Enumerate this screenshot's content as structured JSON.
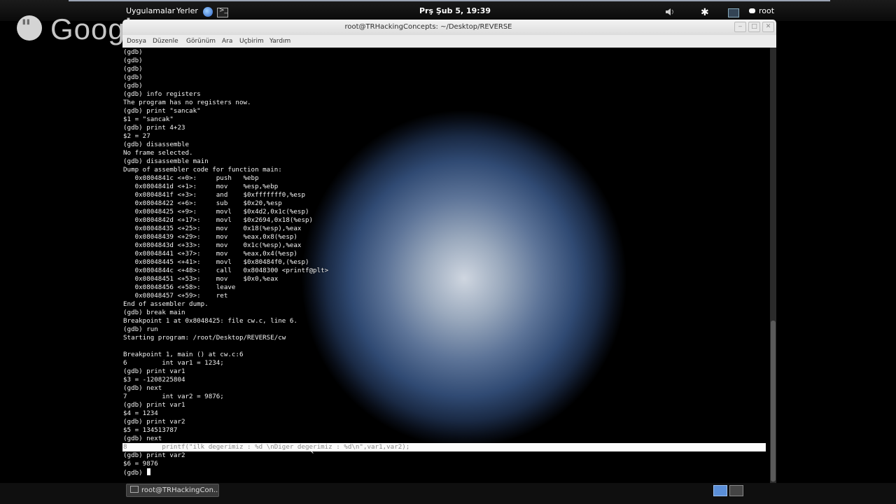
{
  "top_panel": {
    "apps_label": "Uygulamalar",
    "places_label": "Yerler",
    "clock": "Prş Şub  5, 19:39",
    "user": "root"
  },
  "overlay": {
    "wordmark": "Google+"
  },
  "window": {
    "title": "root@TRHackingConcepts: ~/Desktop/REVERSE",
    "menu": [
      "Dosya",
      "Düzenle",
      "Görünüm",
      "Ara",
      "Uçbirim",
      "Yardım"
    ]
  },
  "terminal": {
    "lines": [
      "(gdb)",
      "(gdb)",
      "(gdb)",
      "(gdb)",
      "(gdb)",
      "(gdb) info registers",
      "The program has no registers now.",
      "(gdb) print \"sancak\"",
      "$1 = \"sancak\"",
      "(gdb) print 4+23",
      "$2 = 27",
      "(gdb) disassemble",
      "No frame selected.",
      "(gdb) disassemble main",
      "Dump of assembler code for function main:",
      "   0x0804841c <+0>:     push   %ebp",
      "   0x0804841d <+1>:     mov    %esp,%ebp",
      "   0x0804841f <+3>:     and    $0xfffffff0,%esp",
      "   0x08048422 <+6>:     sub    $0x20,%esp",
      "   0x08048425 <+9>:     movl   $0x4d2,0x1c(%esp)",
      "   0x0804842d <+17>:    movl   $0x2694,0x18(%esp)",
      "   0x08048435 <+25>:    mov    0x18(%esp),%eax",
      "   0x08048439 <+29>:    mov    %eax,0x8(%esp)",
      "   0x0804843d <+33>:    mov    0x1c(%esp),%eax",
      "   0x08048441 <+37>:    mov    %eax,0x4(%esp)",
      "   0x08048445 <+41>:    movl   $0x80484f0,(%esp)",
      "   0x0804844c <+48>:    call   0x8048300 <printf@plt>",
      "   0x08048451 <+53>:    mov    $0x0,%eax",
      "   0x08048456 <+58>:    leave",
      "   0x08048457 <+59>:    ret",
      "End of assembler dump.",
      "(gdb) break main",
      "Breakpoint 1 at 0x8048425: file cw.c, line 6.",
      "(gdb) run",
      "Starting program: /root/Desktop/REVERSE/cw",
      "",
      "Breakpoint 1, main () at cw.c:6",
      "6         int var1 = 1234;",
      "(gdb) print var1",
      "$3 = -1208225804",
      "(gdb) next",
      "7         int var2 = 9876;",
      "(gdb) print var1",
      "$4 = 1234",
      "(gdb) print var2",
      "$5 = 134513787",
      "(gdb) next",
      "8         printf(\"ilk degerimiz : %d \\nDiger degerimiz : %d\\n\",var1,var2);",
      "(gdb) print var2",
      "$6 = 9876",
      "(gdb) "
    ]
  },
  "taskbar": {
    "window_label": "root@TRHackingCon..."
  }
}
